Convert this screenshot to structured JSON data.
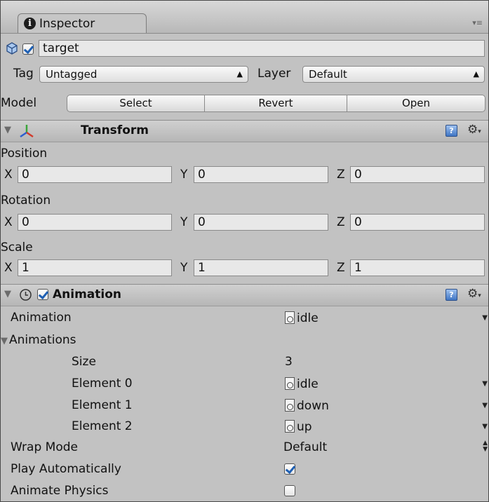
{
  "tab": {
    "label": "Inspector",
    "icon": "info-icon",
    "menu_icon": "tab-menu-icon"
  },
  "gameobject": {
    "name": "target",
    "active": true,
    "icon": "prefab-cube-icon"
  },
  "tag_row": {
    "tag_label": "Tag",
    "tag_value": "Untagged",
    "layer_label": "Layer",
    "layer_value": "Default"
  },
  "model_row": {
    "label": "Model",
    "buttons": [
      "Select",
      "Revert",
      "Open"
    ]
  },
  "transform": {
    "title": "Transform",
    "icon": "transform-axes-icon",
    "position": {
      "label": "Position",
      "x": "0",
      "y": "0",
      "z": "0"
    },
    "rotation": {
      "label": "Rotation",
      "x": "0",
      "y": "0",
      "z": "0"
    },
    "scale": {
      "label": "Scale",
      "x": "1",
      "y": "1",
      "z": "1"
    },
    "axis_x": "X",
    "axis_y": "Y",
    "axis_z": "Z"
  },
  "animation": {
    "title": "Animation",
    "enabled": true,
    "icon": "clock-icon",
    "animation_label": "Animation",
    "animation_value": "idle",
    "animations_label": "Animations",
    "size_label": "Size",
    "size_value": "3",
    "elements": [
      {
        "label": "Element 0",
        "value": "idle"
      },
      {
        "label": "Element 1",
        "value": "down"
      },
      {
        "label": "Element 2",
        "value": "up"
      }
    ],
    "wrap_mode_label": "Wrap Mode",
    "wrap_mode_value": "Default",
    "play_auto_label": "Play Automatically",
    "play_auto_value": true,
    "animate_physics_label": "Animate Physics",
    "animate_physics_value": false
  },
  "colors": {
    "panel": "#c2c2c2",
    "header": "#b6b6b6",
    "field": "#e8e8e8",
    "accent": "#3f75c4"
  }
}
